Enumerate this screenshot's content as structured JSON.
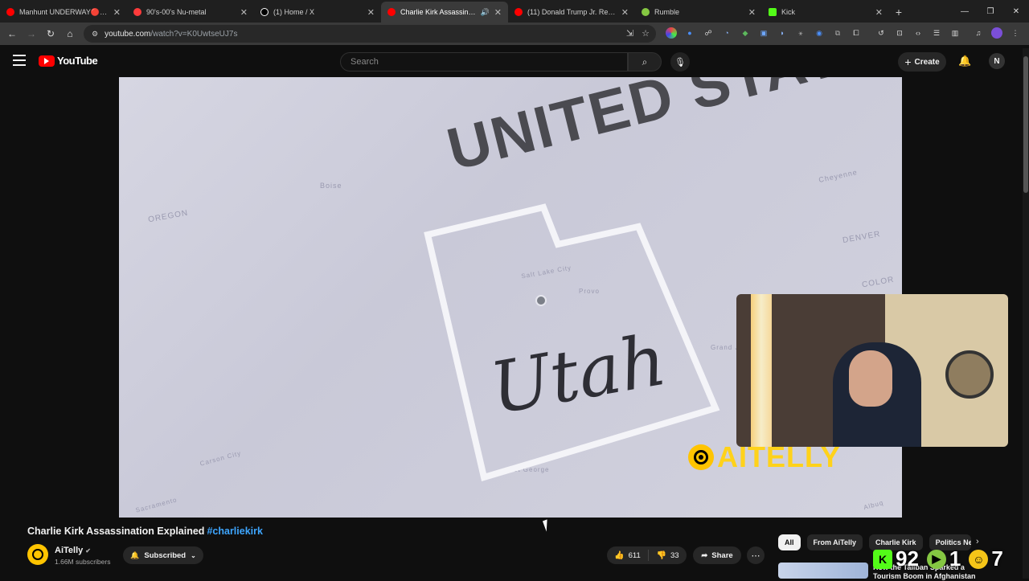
{
  "browser": {
    "tabs": [
      {
        "title": "Manhunt UNDERWAY🔴RIP",
        "favicon_color": "#ff0000",
        "active": false
      },
      {
        "title": "90's-00's Nu-metal",
        "favicon_color": "#ff3b3b",
        "active": false
      },
      {
        "title": "(1) Home / X",
        "favicon_color": "#ffffff",
        "active": false
      },
      {
        "title": "Charlie Kirk Assassination E",
        "favicon_color": "#ff0000",
        "active": true
      },
      {
        "title": "(11) Donald Trump Jr. Reflects o",
        "favicon_color": "#ff0000",
        "active": false
      },
      {
        "title": "Rumble",
        "favicon_color": "#85c742",
        "active": false
      },
      {
        "title": "Kick",
        "favicon_color": "#53fc18",
        "active": false
      }
    ],
    "url": "youtube.com",
    "url_path": "/watch?v=K0UwtseUJ7s"
  },
  "masthead": {
    "logo_text": "YouTube",
    "search_placeholder": "Search",
    "create_label": "Create",
    "avatar_letter": "N"
  },
  "video": {
    "map_heading": "UNITED STATES",
    "state_label": "Utah",
    "watermark": "AITELLY",
    "map_places": [
      "OREGON",
      "DENVER",
      "COLOR",
      "Boise",
      "Cheyenne",
      "Salt Lake City",
      "Provo",
      "Grand Junction",
      "St George",
      "Carson City",
      "Sacramento",
      "Albuq"
    ]
  },
  "details": {
    "title": "Charlie Kirk Assassination Explained",
    "hashtag": "#charliekirk",
    "channel_name": "AiTelly",
    "subscribers": "1.66M subscribers",
    "subscribed_label": "Subscribed",
    "likes": "611",
    "dislikes": "33",
    "share_label": "Share"
  },
  "chips": [
    "All",
    "From AiTelly",
    "Charlie Kirk",
    "Politics New"
  ],
  "recommendation": {
    "title": "How the Taliban Sparked a Tourism Boom in Afghanistan"
  },
  "stream_stats": [
    {
      "icon": "kick-icon",
      "value": "92",
      "color": "#53fc18",
      "letter": "K"
    },
    {
      "icon": "rumble-icon",
      "value": "1",
      "color": "#85c742",
      "letter": "▶"
    },
    {
      "icon": "viewer-icon",
      "value": "7",
      "color": "#f5c518",
      "letter": "☺"
    }
  ]
}
